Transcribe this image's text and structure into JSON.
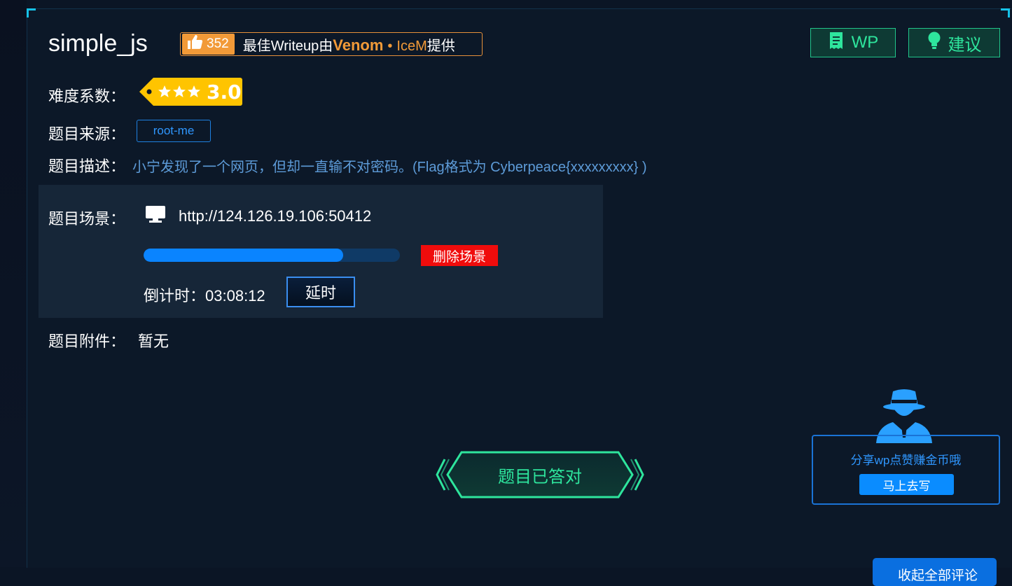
{
  "challenge": {
    "title": "simple_js",
    "likes": "352",
    "writeup_prefix": "最佳Writeup由",
    "writeup_author1": "Venom",
    "writeup_dot": "•",
    "writeup_author2": "IceM",
    "writeup_suffix": "提供"
  },
  "top_buttons": {
    "wp": "WP",
    "suggest": "建议"
  },
  "difficulty": {
    "label": "难度系数：",
    "stars": 3,
    "score": "3.0"
  },
  "source": {
    "label": "题目来源：",
    "value": "root-me"
  },
  "description": {
    "label": "题目描述：",
    "value": "小宁发现了一个网页，但却一直输不对密码。(Flag格式为 Cyberpeace{xxxxxxxxx} )"
  },
  "scene": {
    "label": "题目场景：",
    "url": "http://124.126.19.106:50412",
    "progress": 0.78,
    "delete_button": "删除场景",
    "countdown_label": "倒计时：",
    "countdown_value": "03:08:12",
    "extend_button": "延时"
  },
  "attachment": {
    "label": "题目附件：",
    "value": "暂无"
  },
  "status": {
    "answered": "题目已答对"
  },
  "share": {
    "text": "分享wp点赞赚金币哦",
    "button": "马上去写"
  },
  "bottom_button": "收起全部评论",
  "colors": {
    "background": "#0c1828",
    "accent_green": "#2ee59d",
    "accent_blue": "#0a84ff",
    "like_orange": "#f29a38",
    "delete_red": "#f00c0c",
    "tag_yellow": "#ffc400"
  }
}
